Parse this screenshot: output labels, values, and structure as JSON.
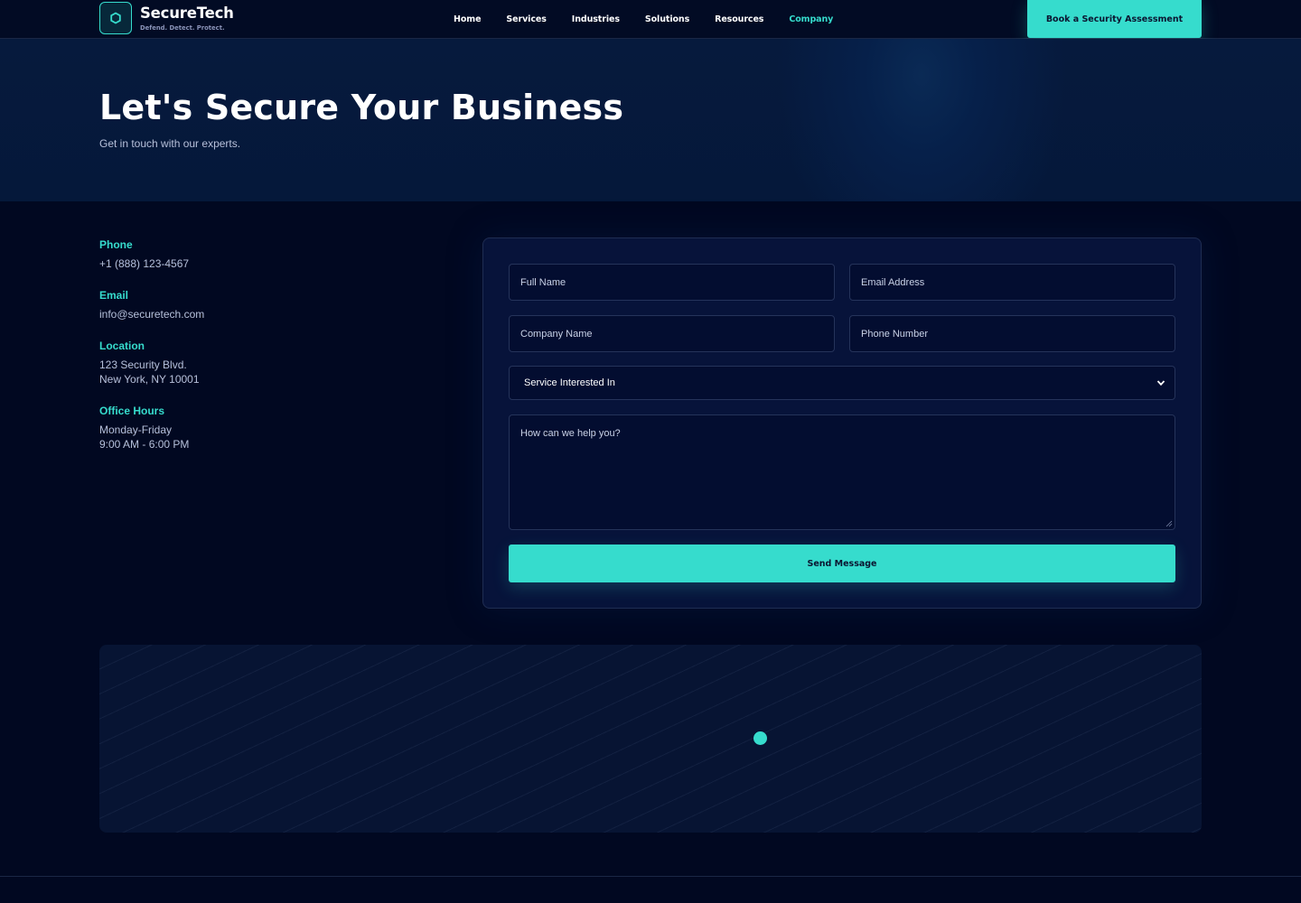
{
  "brand": {
    "name": "SecureTech",
    "tagline": "Defend. Detect. Protect.",
    "accent_color": "#36dccd",
    "logo_icon": "hexagon-icon"
  },
  "nav": {
    "links": [
      "Home",
      "Services",
      "Industries",
      "Solutions",
      "Resources",
      "Company"
    ],
    "active": "Company",
    "cta_label": "Book a Security Assessment"
  },
  "hero": {
    "title": "Let's Secure Your Business",
    "subtitle": "Get in touch with our experts."
  },
  "contact": {
    "phone_label": "Phone",
    "phone": "+1 (888) 123-4567",
    "email_label": "Email",
    "email": "info@securetech.com",
    "location_label": "Location",
    "address_line1": "123 Security Blvd.",
    "address_line2": "New York, NY 10001",
    "hours_label": "Office Hours",
    "hours_days": "Monday-Friday",
    "hours_time": "9:00 AM - 6:00 PM"
  },
  "form": {
    "full_name_placeholder": "Full Name",
    "email_placeholder": "Email Address",
    "company_placeholder": "Company Name",
    "phone_placeholder": "Phone Number",
    "service_selected": "Service Interested In",
    "message_placeholder": "How can we help you?",
    "submit_label": "Send Message"
  },
  "map": {
    "pin_icon": "map-pin-icon"
  }
}
